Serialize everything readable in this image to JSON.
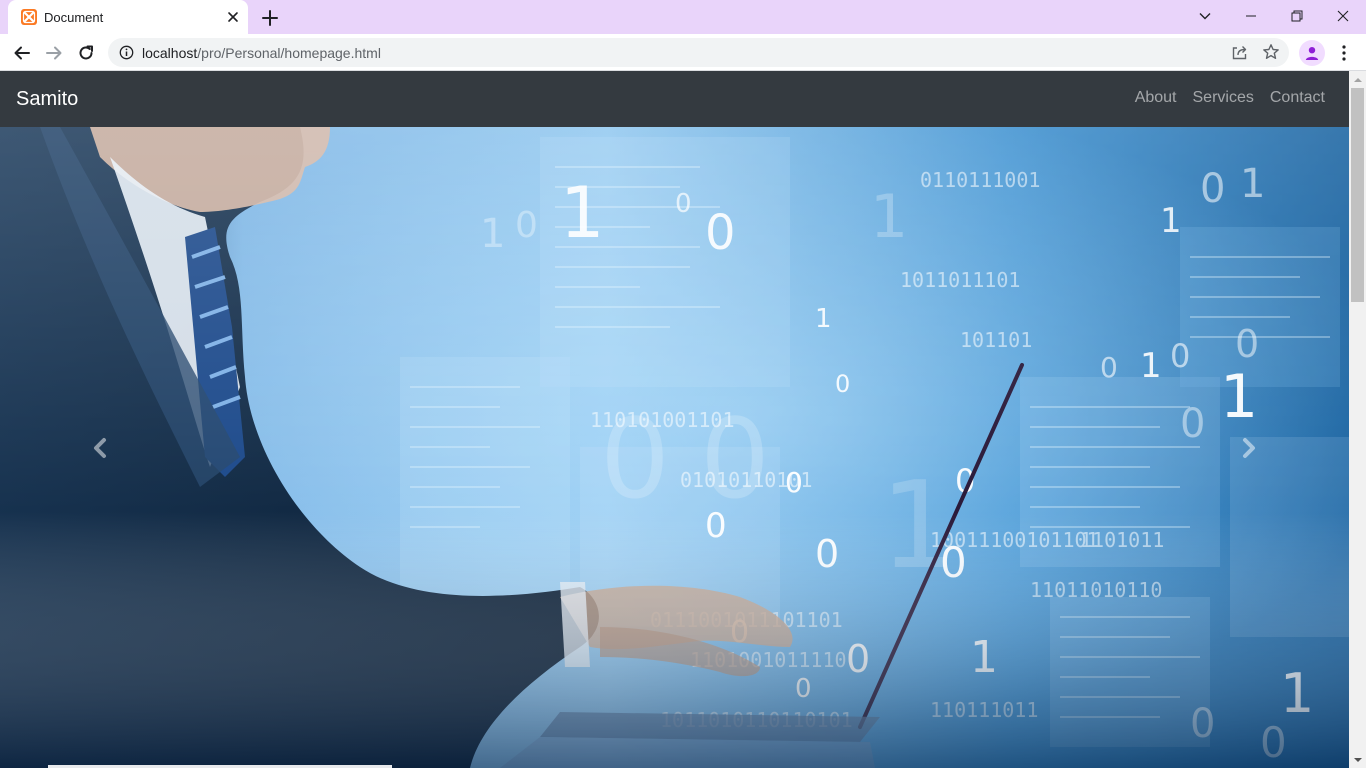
{
  "browser": {
    "tab_title": "Document",
    "favicon_icon": "xampp-icon",
    "url_host": "localhost",
    "url_path": "/pro/Personal/homepage.html",
    "accent_color": "#e9d4fa"
  },
  "site": {
    "brand": "Samito",
    "nav": [
      {
        "label": "About"
      },
      {
        "label": "Services"
      },
      {
        "label": "Contact"
      }
    ],
    "navbar_color": "#343a40"
  },
  "carousel": {
    "prev_icon": "chevron-left-icon",
    "next_icon": "chevron-right-icon",
    "hero_description_icon": "hero-image"
  }
}
